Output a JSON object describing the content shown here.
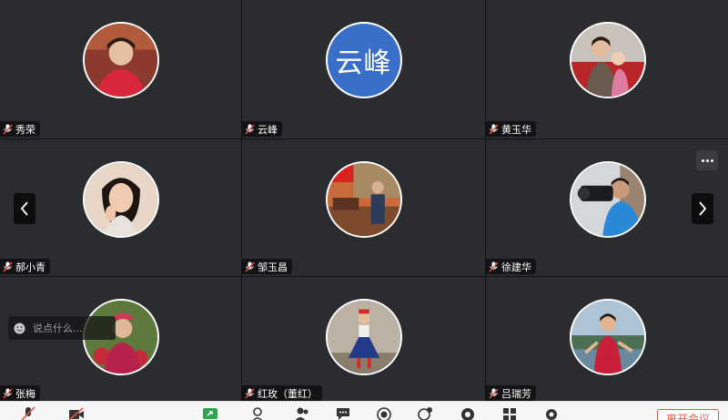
{
  "participants": [
    {
      "name": "秀荣"
    },
    {
      "name": "云峰",
      "avatar_text": "云峰"
    },
    {
      "name": "黄玉华"
    },
    {
      "name": "郝小青"
    },
    {
      "name": "邹玉昌"
    },
    {
      "name": "徐建华"
    },
    {
      "name": "张梅"
    },
    {
      "name": "红玫（董红）"
    },
    {
      "name": "吕瑞芳"
    }
  ],
  "chat": {
    "placeholder": "说点什么..."
  },
  "toolbar": {
    "leave_label": "离开会议"
  },
  "colors": {
    "accent_blue": "#3a6fc9",
    "leave_red": "#e2574c",
    "tile_bg": "#2b2c30"
  }
}
